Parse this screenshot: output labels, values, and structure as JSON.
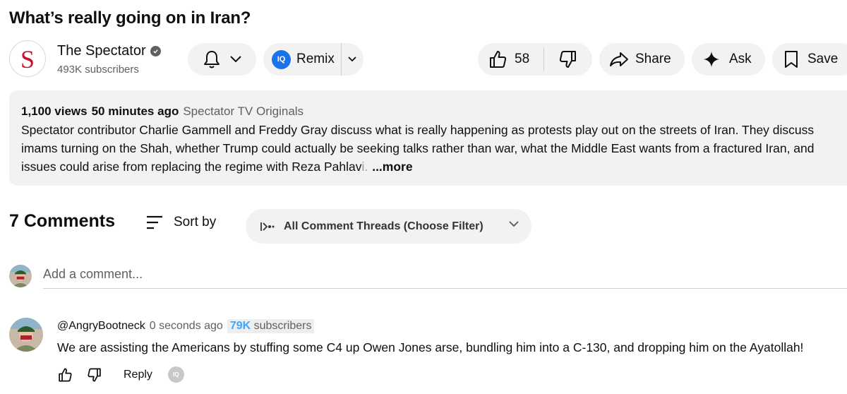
{
  "video": {
    "title": "What’s really going on in Iran?"
  },
  "channel": {
    "avatar_letter": "S",
    "name": "The Spectator",
    "subscribers": "493K subscribers"
  },
  "actions": {
    "remix_logo": "IQ",
    "remix_label": "Remix",
    "likes": "58",
    "share_label": "Share",
    "ask_label": "Ask",
    "save_label": "Save"
  },
  "description": {
    "views": "1,100 views",
    "time": "50 minutes ago",
    "category": "Spectator TV Originals",
    "line1": "Spectator contributor Charlie Gammell and Freddy Gray discuss what is really happening as protests play out on the streets of Iran. They discuss",
    "line2": "imams turning on the Shah, whether Trump could actually be seeking talks rather than war, what the Middle East wants from a fractured Iran, and",
    "line3": "issues could arise from replacing the regime with Reza Pahlav",
    "line3_fade": "i.",
    "more": "...more"
  },
  "comments_section": {
    "count_label": "7 Comments",
    "sort_label": "Sort by",
    "filter_label": "All Comment Threads (Choose Filter)",
    "add_placeholder": "Add a comment..."
  },
  "comments": [
    {
      "author": "@AngryBootneck",
      "time": "0 seconds ago",
      "badge_count": "79K",
      "badge_suffix": " subscribers",
      "text": "We are assisting the Americans by stuffing some C4 up Owen Jones arse, bundling him into a C-130, and dropping him on the Ayatollah!",
      "reply_label": "Reply",
      "iq_label": "IQ"
    }
  ],
  "colors": {
    "accent": "#1a73e8",
    "brand_red": "#c8102e",
    "badge_blue": "#3ea6ff",
    "pill_bg": "#f2f2f2"
  }
}
